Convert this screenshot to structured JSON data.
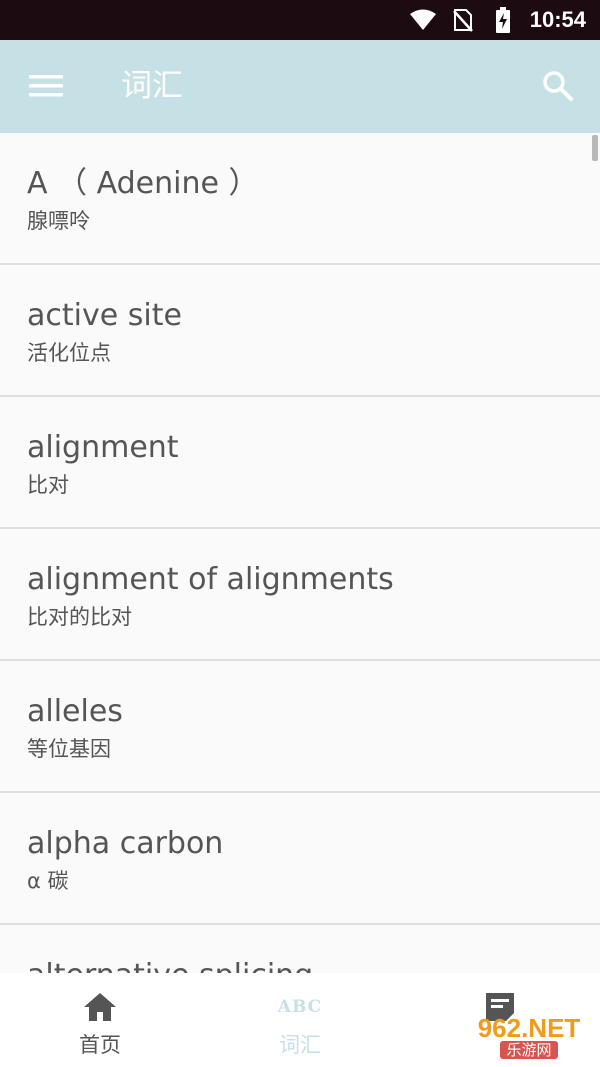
{
  "status_bar": {
    "time": "10:54",
    "icons": [
      "wifi-icon",
      "no-sim-icon",
      "battery-charging-icon"
    ]
  },
  "app_bar": {
    "title": "词汇",
    "menu_icon": "hamburger-menu-icon",
    "search_icon": "search-icon",
    "background": "#c6e1e5"
  },
  "vocabulary": [
    {
      "term": "A （ Adenine ）",
      "meaning": "腺嘌呤"
    },
    {
      "term": "active site",
      "meaning": "活化位点"
    },
    {
      "term": "alignment",
      "meaning": "比对"
    },
    {
      "term": "alignment of alignments",
      "meaning": "比对的比对"
    },
    {
      "term": "alleles",
      "meaning": "等位基因"
    },
    {
      "term": "alpha carbon",
      "meaning": "α 碳"
    },
    {
      "term": "alternative splicing",
      "meaning": ""
    }
  ],
  "bottom_nav": {
    "items": [
      {
        "label": "首页",
        "icon": "home-icon",
        "active": false
      },
      {
        "label": "词汇",
        "icon": "abc-icon",
        "icon_text": "ABC",
        "active": true
      },
      {
        "label": "",
        "icon": "note-icon",
        "active": false
      }
    ]
  },
  "watermark": {
    "top": "962.NET",
    "bottom": "乐游网"
  },
  "colors": {
    "accent": "#c6e1e5",
    "status_bar": "#1d0b12",
    "text": "#555555",
    "divider": "#dedede"
  }
}
